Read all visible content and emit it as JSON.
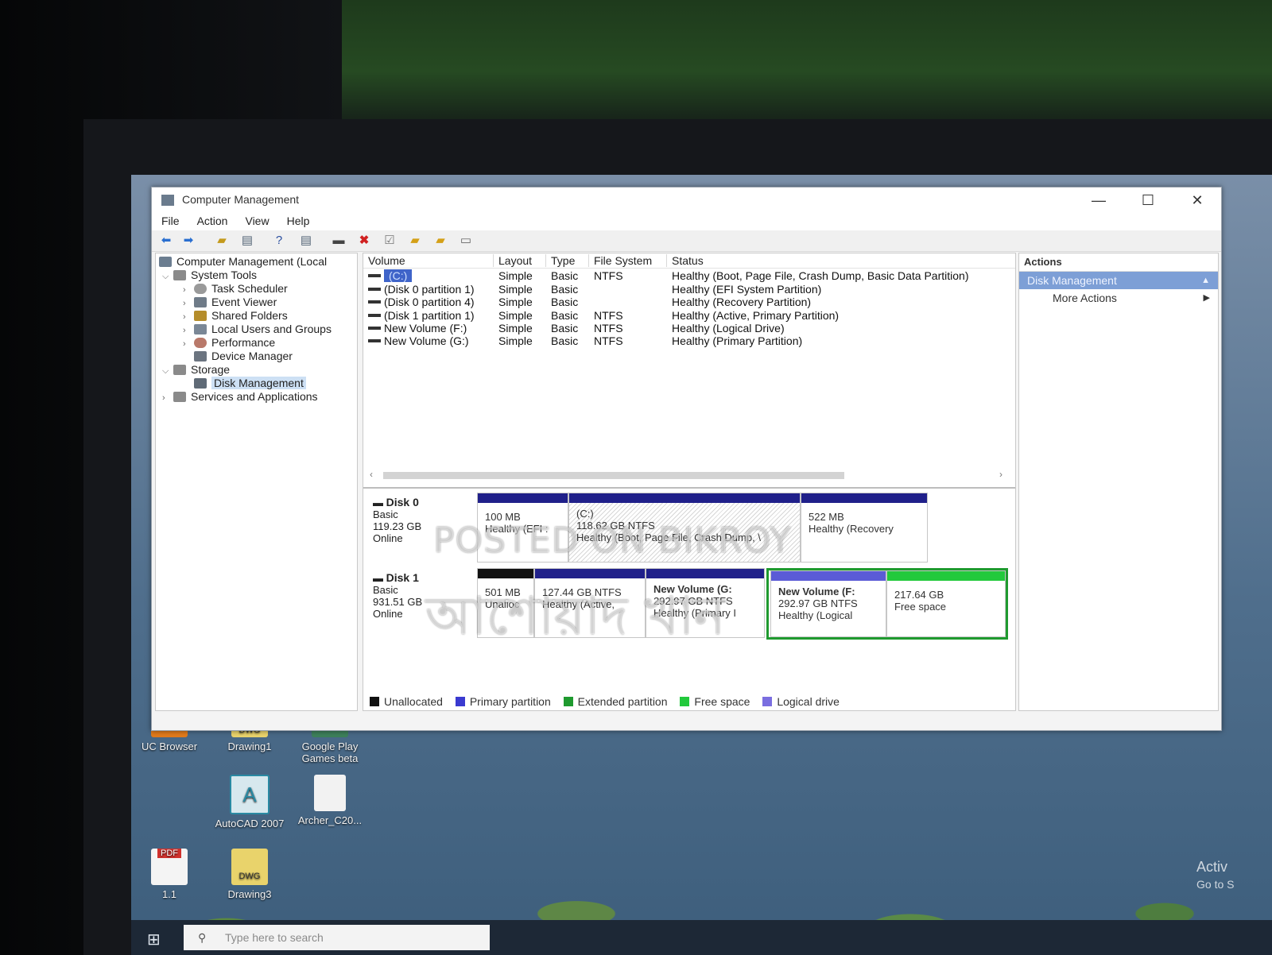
{
  "window": {
    "title": "Computer Management",
    "controls": {
      "minimize": "—",
      "maximize": "☐",
      "close": "✕"
    },
    "menu": [
      "File",
      "Action",
      "View",
      "Help"
    ]
  },
  "tree": {
    "root": "Computer Management (Local",
    "system_tools": "System Tools",
    "task_scheduler": "Task Scheduler",
    "event_viewer": "Event Viewer",
    "shared_folders": "Shared Folders",
    "local_users": "Local Users and Groups",
    "performance": "Performance",
    "device_manager": "Device Manager",
    "storage": "Storage",
    "disk_management": "Disk Management",
    "services": "Services and Applications"
  },
  "volumes": {
    "headers": [
      "Volume",
      "Layout",
      "Type",
      "File System",
      "Status"
    ],
    "rows": [
      {
        "name": "(C:)",
        "layout": "Simple",
        "type": "Basic",
        "fs": "NTFS",
        "status": "Healthy (Boot, Page File, Crash Dump, Basic Data Partition)"
      },
      {
        "name": "(Disk 0 partition 1)",
        "layout": "Simple",
        "type": "Basic",
        "fs": "",
        "status": "Healthy (EFI System Partition)"
      },
      {
        "name": "(Disk 0 partition 4)",
        "layout": "Simple",
        "type": "Basic",
        "fs": "",
        "status": "Healthy (Recovery Partition)"
      },
      {
        "name": "(Disk 1 partition 1)",
        "layout": "Simple",
        "type": "Basic",
        "fs": "NTFS",
        "status": "Healthy (Active, Primary Partition)"
      },
      {
        "name": "New Volume (F:)",
        "layout": "Simple",
        "type": "Basic",
        "fs": "NTFS",
        "status": "Healthy (Logical Drive)"
      },
      {
        "name": "New Volume (G:)",
        "layout": "Simple",
        "type": "Basic",
        "fs": "NTFS",
        "status": "Healthy (Primary Partition)"
      }
    ]
  },
  "disks": {
    "disk0": {
      "name": "Disk 0",
      "type": "Basic",
      "size": "119.23 GB",
      "state": "Online",
      "partitions": [
        {
          "label": "",
          "size": "100 MB",
          "status": "Healthy (EFI :"
        },
        {
          "label": "(C:)",
          "size": "118.62 GB NTFS",
          "status": "Healthy (Boot, Page File, Crash Dump, \\"
        },
        {
          "label": "",
          "size": "522 MB",
          "status": "Healthy (Recovery"
        }
      ]
    },
    "disk1": {
      "name": "Disk 1",
      "type": "Basic",
      "size": "931.51 GB",
      "state": "Online",
      "partitions": [
        {
          "label": "",
          "size": "501 MB",
          "status": "Unalloc"
        },
        {
          "label": "",
          "size": "127.44 GB NTFS",
          "status": "Healthy (Active,"
        },
        {
          "label": "New Volume (G:",
          "size": "292.97 GB NTFS",
          "status": "Healthy (Primary I"
        },
        {
          "label": "New Volume (F:",
          "size": "292.97 GB NTFS",
          "status": "Healthy (Logical"
        },
        {
          "label": "",
          "size": "217.64 GB",
          "status": "Free space"
        }
      ]
    }
  },
  "legend": [
    {
      "label": "Unallocated",
      "color": "#111111"
    },
    {
      "label": "Primary partition",
      "color": "#3a3ad0"
    },
    {
      "label": "Extended partition",
      "color": "#1f9a2f"
    },
    {
      "label": "Free space",
      "color": "#22c93c"
    },
    {
      "label": "Logical drive",
      "color": "#7a6ee0"
    }
  ],
  "actions": {
    "header": "Actions",
    "selected": "Disk Management",
    "more": "More Actions"
  },
  "desktop": {
    "icons": [
      {
        "label": "UC Browser"
      },
      {
        "label": "Drawing1",
        "badge": "DWG"
      },
      {
        "label": "Google Play Games beta"
      },
      {
        "label": "AutoCAD 2007"
      },
      {
        "label": "Archer_C20..."
      },
      {
        "label": "1.1",
        "badge": "PDF"
      },
      {
        "label": "Drawing3",
        "badge": "DWG"
      }
    ],
    "search_placeholder": "Type here to search",
    "activate_line1": "Activ",
    "activate_line2": "Go to S"
  },
  "watermarks": {
    "top": "POSTED ON BIKROY",
    "bottom": "আশোয়াদ খান"
  },
  "colors": {
    "primary_bar": "#20208a",
    "logical_bar": "#5b5bd6",
    "free_bar": "#22c93c",
    "extended_border": "#1f9a2f",
    "selection": "#3f64c9"
  }
}
